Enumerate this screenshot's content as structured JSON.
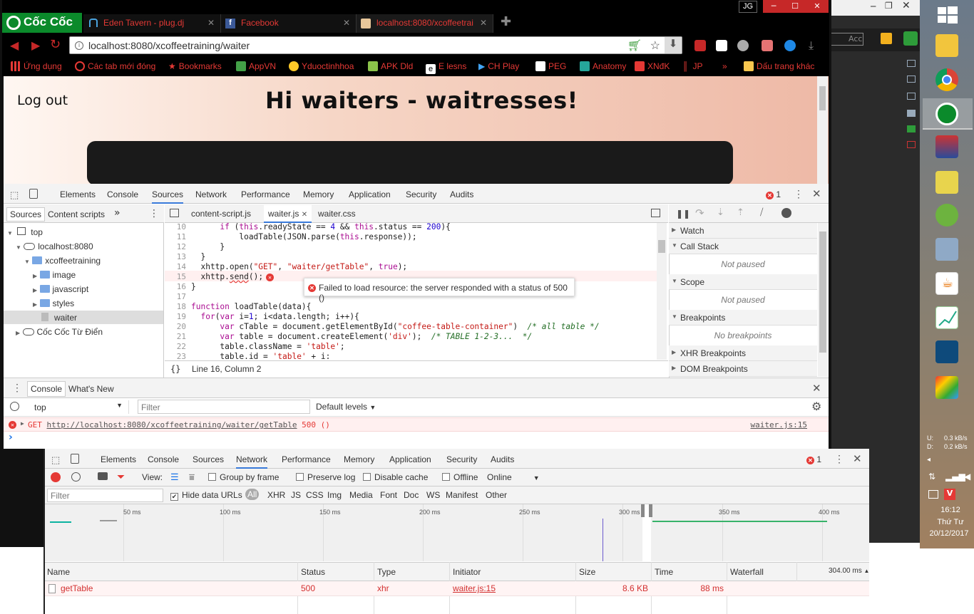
{
  "browser": {
    "brand": "Cốc Cốc",
    "tabs": [
      {
        "title": "Eden Tavern - plug.dj"
      },
      {
        "title": "Facebook"
      },
      {
        "title": "localhost:8080/xcoffeetrai"
      }
    ],
    "profile": "JG",
    "url": "localhost:8080/xcoffeetraining/waiter",
    "bookmarks": [
      "Ứng dụng",
      "Các tab mới đóng",
      "Bookmarks",
      "AppVN",
      "Yduoctinhhoa",
      "APK Dld",
      "E lesns",
      "CH Play",
      "PEG",
      "Anatomy",
      "XNđK",
      "JP",
      "»",
      "Dấu trang khác"
    ],
    "accent": "#e53935"
  },
  "page": {
    "logout": "Log out",
    "heading": "Hi waiters - waitresses!"
  },
  "devtools": {
    "tabs": [
      "Elements",
      "Console",
      "Sources",
      "Network",
      "Performance",
      "Memory",
      "Application",
      "Security",
      "Audits"
    ],
    "active_tab": "Sources",
    "error_count": "1",
    "navigator": {
      "tabs": [
        "Sources",
        "Content scripts",
        "»"
      ],
      "tree": {
        "top": "top",
        "host": "localhost:8080",
        "project": "xcoffeetraining",
        "folders": [
          "image",
          "javascript",
          "styles"
        ],
        "file": "waiter",
        "other": "Cốc Cốc Từ Điển"
      }
    },
    "editor": {
      "files": [
        "content-script.js",
        "waiter.js",
        "waiter.css"
      ],
      "line_numbers": [
        "10",
        "11",
        "12",
        "13",
        "14",
        "15",
        "16",
        "17",
        "18",
        "19",
        "20",
        "21",
        "22",
        "23"
      ],
      "error_tooltip": "Failed to load resource: the server responded with a status of 500 ()",
      "cursor": "Line 16, Column 2",
      "format_label": "{}"
    },
    "debugger": {
      "sections": [
        "Watch",
        "Call Stack",
        "Scope",
        "Breakpoints",
        "XHR Breakpoints",
        "DOM Breakpoints"
      ],
      "not_paused": "Not paused",
      "no_breakpoints": "No breakpoints"
    },
    "console": {
      "tabs": [
        "Console",
        "What's New"
      ],
      "context": "top",
      "filter_placeholder": "Filter",
      "levels": "Default levels",
      "error": {
        "method": "GET",
        "url": "http://localhost:8080/xcoffeetraining/waiter/getTable",
        "status": "500 ()",
        "source": "waiter.js:15"
      },
      "prompt": "›"
    }
  },
  "network_devtools": {
    "tabs": [
      "Elements",
      "Console",
      "Sources",
      "Network",
      "Performance",
      "Memory",
      "Application",
      "Security",
      "Audits"
    ],
    "active_tab": "Network",
    "error_count": "1",
    "view_label": "View:",
    "group_by_frame": "Group by frame",
    "preserve_log": "Preserve log",
    "disable_cache": "Disable cache",
    "offline": "Offline",
    "throttle": "Online",
    "filter_placeholder": "Filter",
    "hide_data_urls": "Hide data URLs",
    "types": [
      "All",
      "XHR",
      "JS",
      "CSS",
      "Img",
      "Media",
      "Font",
      "Doc",
      "WS",
      "Manifest",
      "Other"
    ],
    "ticks": [
      "50 ms",
      "100 ms",
      "150 ms",
      "200 ms",
      "250 ms",
      "300 ms",
      "350 ms",
      "400 ms"
    ],
    "columns": [
      "Name",
      "Status",
      "Type",
      "Initiator",
      "Size",
      "Time",
      "Waterfall"
    ],
    "waterfall_scale": "304.00 ms",
    "rows": [
      {
        "name": "getTable",
        "status": "500",
        "type": "xhr",
        "initiator": "waiter.js:15",
        "size": "8.6 KB",
        "time": "88 ms"
      }
    ]
  },
  "taskbar": {
    "upload": "U:",
    "upload_rate": "0.3 kB/s",
    "download": "D:",
    "download_rate": "0.2 kB/s",
    "time": "16:12",
    "day": "Thứ Tư",
    "date": "20/12/2017"
  },
  "behind_window": {
    "access_label": "Acces"
  }
}
